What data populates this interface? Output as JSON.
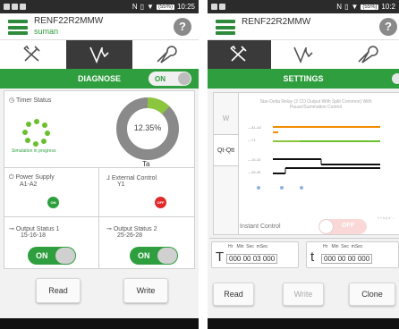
{
  "statusbar": {
    "time_left": "10:25",
    "time_right": "10:2",
    "battery": "(55%)"
  },
  "appbar": {
    "device_name": "RENF22R2MMW",
    "user_name": "suman",
    "help_symbol": "?"
  },
  "diagnose": {
    "title": "DIAGNOSE",
    "toggle": "ON",
    "timer_status_label": "Timer Status",
    "simulation_text": "Simulation in progress",
    "percent": "12.35%",
    "progress": 0.1235,
    "timer_label": "Ta",
    "power_supply": {
      "label": "Power Supply",
      "sub": "A1-A2",
      "state": "ON"
    },
    "external_control": {
      "label": "External Control",
      "sub": "Y1",
      "state": "OFF"
    },
    "output1": {
      "label": "Output Status 1",
      "sub": "15-16-18",
      "state": "ON"
    },
    "output2": {
      "label": "Output Status 2",
      "sub": "25-26-28",
      "state": "ON"
    },
    "read_label": "Read",
    "write_label": "Write"
  },
  "settings": {
    "title": "SETTINGS",
    "mode_w": "W",
    "mode_qt": "Qt-Qtt",
    "diagram_title": "Star-Delta Relay (2 CO Output With Split Common) With Pause/Summation Control",
    "diagram_axis": "t = s p s ...",
    "instant_control_label": "Instant Control",
    "instant_control_state": "OFF",
    "time_units": "Hr   Min  Sec  mSec",
    "t_symbol": "T",
    "t_value": "000 00 03 000",
    "t2_symbol": "t",
    "t2_value": "000 00 00 000",
    "read_label": "Read",
    "write_label": "Write",
    "clone_label": "Clone"
  },
  "colors": {
    "green": "#2e9e3e",
    "dark": "#3a3a3a",
    "orange": "#f28c00",
    "red": "#e02a2a",
    "lime": "#8cc63f"
  }
}
